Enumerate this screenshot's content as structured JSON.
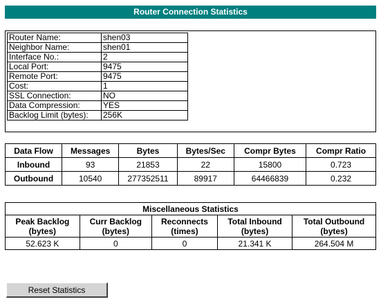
{
  "header": {
    "title": "Router Connection Statistics"
  },
  "router_info": [
    {
      "label": "Router Name:",
      "value": "shen03"
    },
    {
      "label": "Neighbor Name:",
      "value": "shen01"
    },
    {
      "label": "Interface No.:",
      "value": "2"
    },
    {
      "label": "Local Port:",
      "value": "9475"
    },
    {
      "label": "Remote Port:",
      "value": "9475"
    },
    {
      "label": "Cost:",
      "value": "1"
    },
    {
      "label": "SSL Connection:",
      "value": "NO"
    },
    {
      "label": "Data Compression:",
      "value": "YES"
    },
    {
      "label": "Backlog Limit (bytes):",
      "value": "256K"
    }
  ],
  "data_flow": {
    "headers": [
      "Data Flow",
      "Messages",
      "Bytes",
      "Bytes/Sec",
      "Compr Bytes",
      "Compr Ratio"
    ],
    "rows": [
      [
        "Inbound",
        "93",
        "21853",
        "22",
        "15800",
        "0.723"
      ],
      [
        "Outbound",
        "10540",
        "277352511",
        "89917",
        "64466839",
        "0.232"
      ]
    ]
  },
  "misc": {
    "title": "Miscellaneous Statistics",
    "headers": [
      {
        "line1": "Peak Backlog",
        "line2": "(bytes)"
      },
      {
        "line1": "Curr Backlog",
        "line2": "(bytes)"
      },
      {
        "line1": "Reconnects",
        "line2": "(times)"
      },
      {
        "line1": "Total Inbound",
        "line2": "(bytes)"
      },
      {
        "line1": "Total Outbound",
        "line2": "(bytes)"
      }
    ],
    "values": [
      "52.623 K",
      "0",
      "0",
      "21.341 K",
      "264.504 M"
    ]
  },
  "actions": {
    "reset_label": "Reset Statistics"
  }
}
